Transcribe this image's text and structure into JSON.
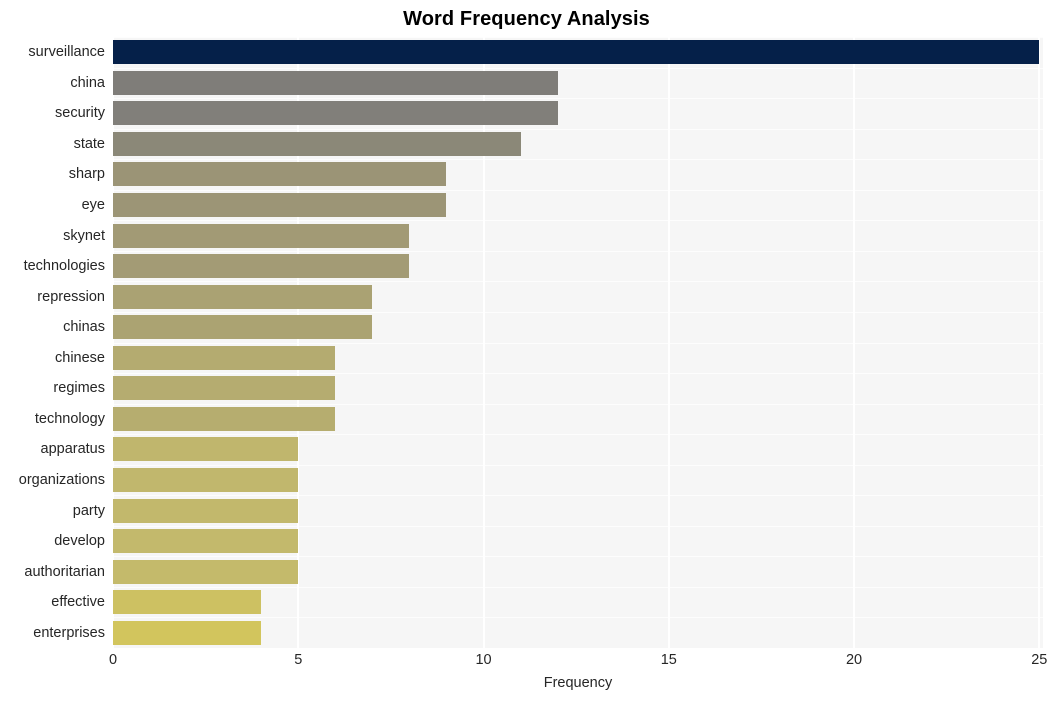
{
  "chart_data": {
    "type": "bar",
    "orientation": "horizontal",
    "title": "Word Frequency Analysis",
    "xlabel": "Frequency",
    "ylabel": "",
    "categories": [
      "surveillance",
      "china",
      "security",
      "state",
      "sharp",
      "eye",
      "skynet",
      "technologies",
      "repression",
      "chinas",
      "chinese",
      "regimes",
      "technology",
      "apparatus",
      "organizations",
      "party",
      "develop",
      "authoritarian",
      "effective",
      "enterprises"
    ],
    "values": [
      25,
      12,
      12,
      11,
      9,
      9,
      8,
      8,
      7,
      7,
      6,
      6,
      6,
      5,
      5,
      5,
      5,
      5,
      4,
      4
    ],
    "bar_colors": [
      "#052049",
      "#7f7d79",
      "#817f7a",
      "#8b8878",
      "#9b9476",
      "#9c9576",
      "#a29a75",
      "#a39b75",
      "#aaa273",
      "#aba372",
      "#b4ab70",
      "#b5ac70",
      "#b6ad6f",
      "#c0b66d",
      "#c1b76d",
      "#c2b86c",
      "#c3b96c",
      "#c4ba6b",
      "#cdc162",
      "#d2c55d"
    ],
    "xticks": [
      0,
      5,
      10,
      15,
      20,
      25
    ],
    "xlim": [
      0,
      25.1
    ],
    "grid": true,
    "legend": null,
    "plot_background": "#f6f6f6",
    "figure_background": "#ffffff",
    "gridline_color": "#ffffff",
    "text_color": "#262626"
  }
}
